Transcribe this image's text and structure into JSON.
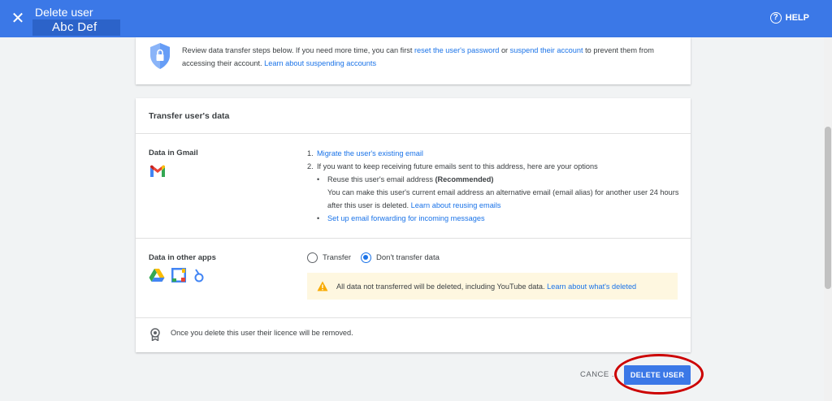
{
  "header": {
    "title": "Delete user",
    "user_name": "Abc Def",
    "help_label": "HELP",
    "close_glyph": "✕",
    "help_glyph": "?"
  },
  "notice": {
    "text_1": "Review data transfer steps below. If you need more time, you can first ",
    "link_reset": "reset the user's password",
    "text_2": " or ",
    "link_suspend": "suspend their account",
    "text_3": " to prevent them from accessing their account. ",
    "link_learn": "Learn about suspending accounts"
  },
  "transfer": {
    "title": "Transfer user's data",
    "gmail": {
      "label": "Data in Gmail",
      "item1_num": "1.",
      "item1_link": "Migrate the user's existing email",
      "item2_num": "2.",
      "item2_text": "If you want to keep receiving future emails sent to this address, here are your options",
      "bullet1_text": "Reuse this user's email address ",
      "bullet1_bold": "(Recommended)",
      "bullet1_desc": "You can make this user's current email address an alternative email (email alias) for another user 24 hours after this user is deleted. ",
      "bullet1_link": "Learn about reusing emails",
      "bullet2_link": "Set up email forwarding for incoming messages",
      "bullet_glyph": "•"
    },
    "other_apps": {
      "label": "Data in other apps",
      "option_transfer": "Transfer",
      "option_dont": "Don't transfer data",
      "selected": "Don't transfer data",
      "warning_text": "All data not transferred will be deleted, including YouTube data. ",
      "warning_link": "Learn about what's deleted"
    },
    "licence_text": "Once you delete this user their licence will be removed."
  },
  "footer": {
    "cancel_label": "CANCE .",
    "delete_label": "DELETE USER"
  },
  "colors": {
    "accent": "#3b78e7",
    "link": "#1a73e8",
    "warning_bg": "#fef7e0",
    "annotation": "#cc0000"
  },
  "icons": [
    "close-icon",
    "help-icon",
    "shield-lock-icon",
    "gmail-icon",
    "drive-icon",
    "calendar-icon",
    "groups-icon",
    "warning-icon",
    "licence-icon"
  ]
}
